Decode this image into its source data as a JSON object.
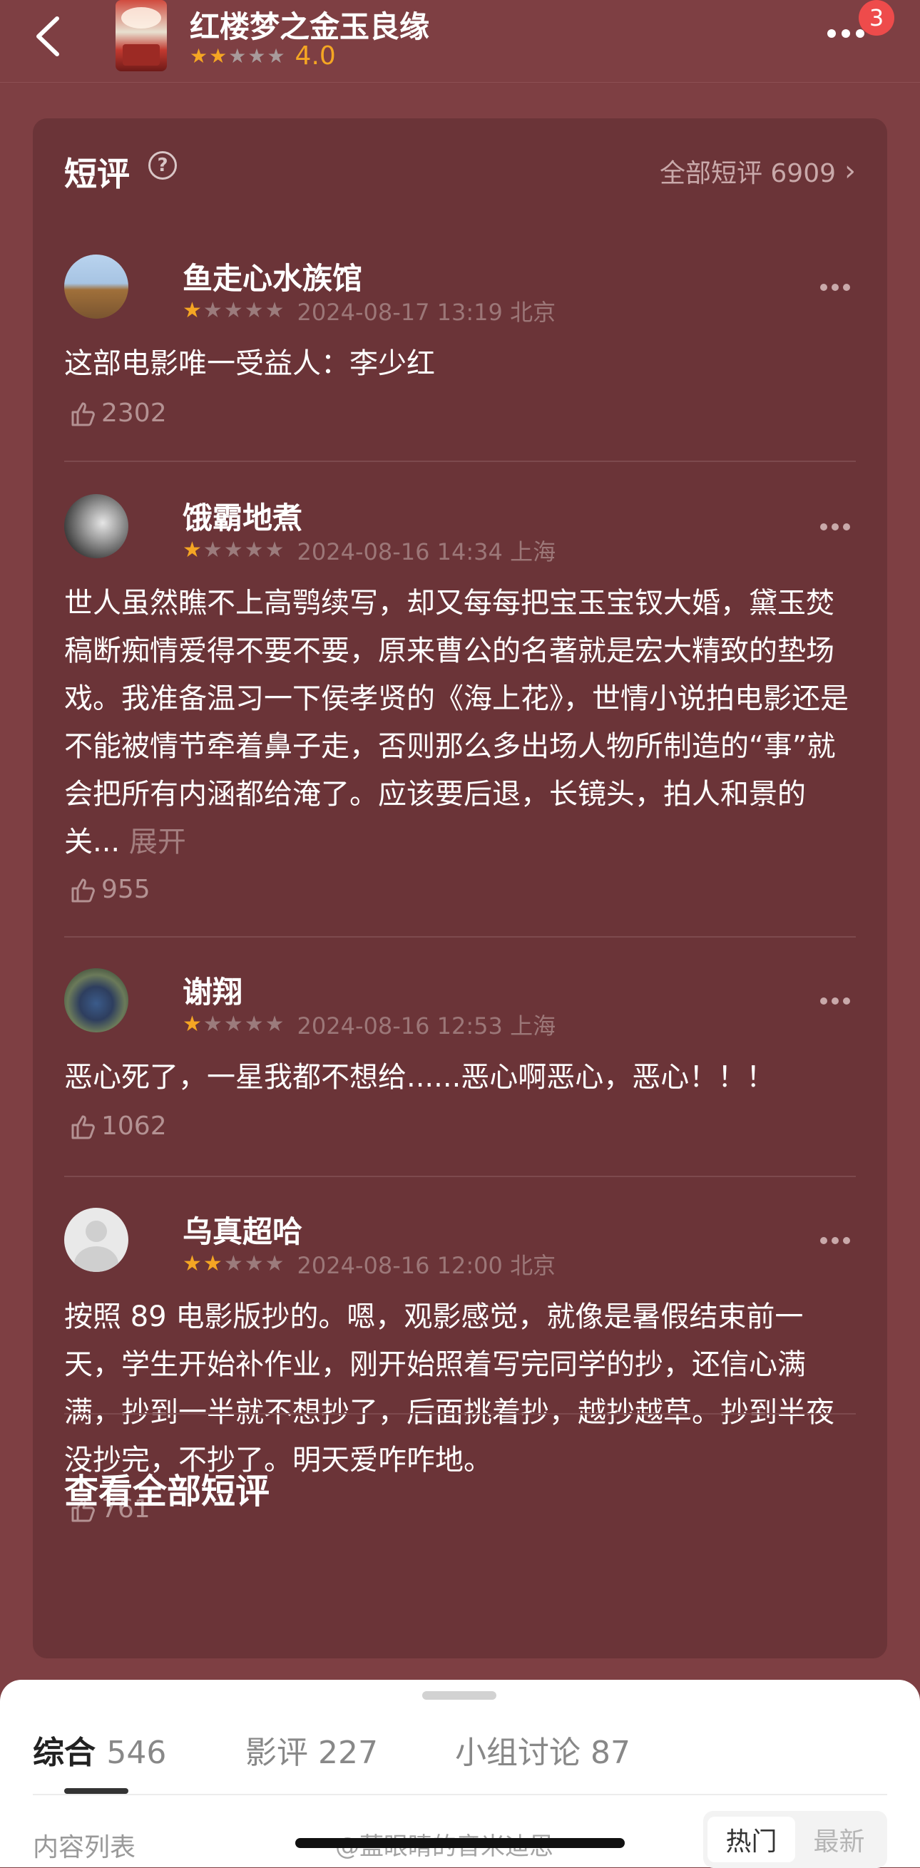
{
  "header": {
    "movie_title": "红楼梦之金玉良缘",
    "rating_score": "4.0",
    "rating_stars": 2,
    "notification_count": "3"
  },
  "card": {
    "title": "短评",
    "all_link": "全部短评 6909",
    "view_all": "查看全部短评"
  },
  "reviews": [
    {
      "user": "鱼走心水族馆",
      "stars": 1,
      "meta": "2024-08-17 13:19 北京",
      "content": "这部电影唯一受益人：李少红",
      "likes": "2302"
    },
    {
      "user": "饿霸地煮",
      "stars": 1,
      "meta": "2024-08-16 14:34 上海",
      "content": "世人虽然瞧不上高鹗续写，却又每每把宝玉宝钗大婚，黛玉焚稿断痴情爱得不要不要，原来曹公的名著就是宏大精致的垫场戏。我准备温习一下侯孝贤的《海上花》，世情小说拍电影还是不能被情节牵着鼻子走，否则那么多出场人物所制造的“事”就会把所有内涵都给淹了。应该要后退，长镜头，拍人和景的关...",
      "expand": "展开",
      "likes": "955"
    },
    {
      "user": "谢翔",
      "stars": 1,
      "meta": "2024-08-16 12:53 上海",
      "content": "恶心死了，一星我都不想给......恶心啊恶心，恶心！！！",
      "likes": "1062"
    },
    {
      "user": "乌真超哈",
      "stars": 2,
      "meta": "2024-08-16 12:00 北京",
      "content": "按照 89 电影版抄的。嗯，观影感觉，就像是暑假结束前一天，学生开始补作业，刚开始照着写完同学的抄，还信心满满，抄到一半就不想抄了，后面挑着抄，越抄越草。抄到半夜没抄完，不抄了。明天爱咋咋地。",
      "likes": "761"
    }
  ],
  "tabs": [
    {
      "label": "综合",
      "count": "546",
      "active": true
    },
    {
      "label": "影评",
      "count": "227"
    },
    {
      "label": "小组讨论",
      "count": "87"
    }
  ],
  "list": {
    "label": "内容列表",
    "sort_options": [
      "热门",
      "最新"
    ],
    "sort_active": "热门"
  },
  "watermark": "@蓝眼睛的音米迪恩",
  "colors": {
    "background": "#7e3f43",
    "card": "#6b3438",
    "star": "#f5a623",
    "badge": "#ee4b4b"
  }
}
